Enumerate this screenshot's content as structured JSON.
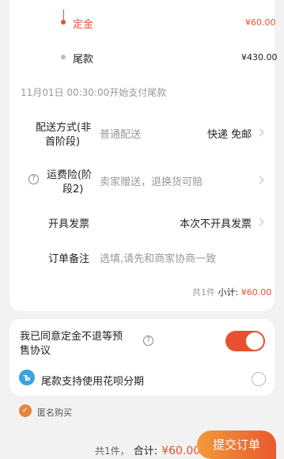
{
  "payment": {
    "deposit_label": "定金",
    "deposit_amount": "¥60.00",
    "balance_label": "尾款",
    "balance_amount": "¥430.00",
    "balance_start": "11月01日 00:30:00开始支付尾款"
  },
  "delivery": {
    "label_line1": "配送方式(非",
    "label_line2": "首阶段)",
    "value": "普通配送",
    "option": "快递 免邮"
  },
  "insurance": {
    "label_line1": "运费险(阶",
    "label_line2": "段2)",
    "value": "卖家赠送，退换货可赔"
  },
  "invoice": {
    "label": "开具发票",
    "value": "本次不开具发票"
  },
  "note": {
    "label": "订单备注",
    "placeholder": "选填,请先和商家协商一致"
  },
  "subtotal": {
    "count": "共1件",
    "label": "小计:",
    "amount": "¥60.00"
  },
  "agreement": {
    "line1": "我已同意定金不退等预",
    "line2": "售协议",
    "enabled": true
  },
  "huabei": {
    "label": "尾款支持使用花呗分期",
    "selected": false
  },
  "anonymous": {
    "label": "匿名购买",
    "checked": true
  },
  "footer": {
    "count": "共1件，",
    "total_label": "合计:",
    "total_amount": "¥60.00",
    "submit_label": "提交订单"
  },
  "colors": {
    "accent": "#e8502f",
    "submit_start": "#f29a3a",
    "submit_end": "#e8582f"
  },
  "icons": [
    "help-icon",
    "chevron-right-icon",
    "huabei-icon",
    "check-icon"
  ]
}
